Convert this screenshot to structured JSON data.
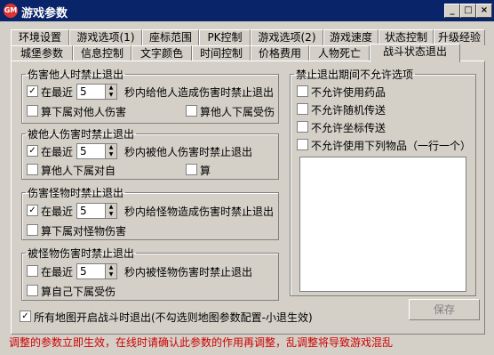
{
  "window": {
    "title": "游戏参数",
    "icon": "app-icon"
  },
  "tabs": {
    "row1": [
      "环境设置",
      "游戏选项(1)",
      "座标范围",
      "PK控制",
      "游戏选项(2)",
      "游戏速度",
      "状态控制",
      "升级经验"
    ],
    "row2": [
      "城堡参数",
      "信息控制",
      "文字颜色",
      "时间控制",
      "价格费用",
      "人物死亡",
      "战斗状态退出"
    ]
  },
  "groups": {
    "g1": {
      "title": "伤害他人时禁止退出",
      "recent_label": "在最近",
      "value": "5",
      "suffix": "秒内给他人造成伤害时禁止退出",
      "opt_a": "算下属对他人伤害",
      "opt_b": "算他人下属受伤"
    },
    "g2": {
      "title": "被他人伤害时禁止退出",
      "recent_label": "在最近",
      "value": "5",
      "suffix": "秒内被他人伤害时禁止退出",
      "opt_a": "算他人下属对自",
      "opt_b": "算"
    },
    "g3": {
      "title": "伤害怪物时禁止退出",
      "recent_label": "在最近",
      "value": "5",
      "suffix": "秒内给怪物造成伤害时禁止退出",
      "opt_a": "算下属对怪物伤害"
    },
    "g4": {
      "title": "被怪物伤害时禁止退出",
      "recent_label": "在最近",
      "value": "5",
      "suffix": "秒内被怪物伤害时禁止退出",
      "opt_a": "算自己下属受伤"
    },
    "g5": {
      "title": "禁止退出期间不允许选项",
      "opts": [
        "不允许使用药品",
        "不允许随机传送",
        "不允许坐标传送",
        "不允许使用下列物品（一行一个）"
      ]
    }
  },
  "all_maps": "所有地图开启战斗时退出(不勾选则地图参数配置-小退生效)",
  "save": "保存",
  "warning": "调整的参数立即生效，在线时请确认此参数的作用再调整，乱调整将导致游戏混乱",
  "colors": {
    "title_bar": "#0a246a",
    "warning": "#d00000"
  }
}
